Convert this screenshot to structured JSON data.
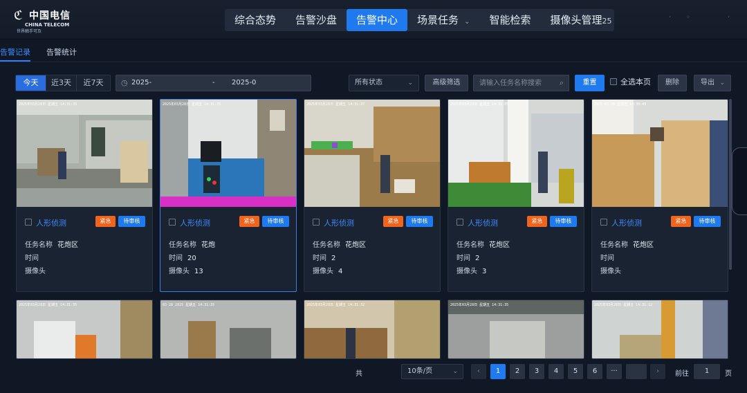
{
  "header": {
    "logo": {
      "cn": "中国电信",
      "en": "CHINA TELECOM",
      "slogan": "世界触手可及"
    },
    "nav": [
      {
        "label": "综合态势"
      },
      {
        "label": "告警沙盘"
      },
      {
        "label": "告警中心",
        "active": true
      },
      {
        "label": "场景任务",
        "has_dropdown": true
      },
      {
        "label": "智能检索"
      },
      {
        "label": "摄像头管理"
      }
    ],
    "nav_overflow": "25"
  },
  "subtabs": [
    {
      "label": "告警记录",
      "active": true
    },
    {
      "label": "告警统计"
    }
  ],
  "toolbar": {
    "ranges": [
      {
        "label": "今天",
        "active": true
      },
      {
        "label": "近3天"
      },
      {
        "label": "近7天"
      }
    ],
    "date_start": "2025-",
    "date_sep": "-",
    "date_end": "2025-0",
    "status_select": "所有状态",
    "advanced_filter": "高级筛选",
    "search_placeholder": "请输入任务名称搜索",
    "reset": "重置",
    "select_all": "全选本页",
    "delete": "删除",
    "export": "导出"
  },
  "cards": [
    {
      "timestamp": "2025年03月28日 星期五 14:31:35",
      "title": "人形侦测",
      "urgent": "紧急",
      "status": "待审核",
      "task_label": "任务名称",
      "task": "花炮区",
      "time_label": "时间",
      "time": "",
      "camera_label": "摄像头",
      "camera": ""
    },
    {
      "timestamp": "2025年03月28日 星期五 14:31:35",
      "title": "人形侦测",
      "urgent": "紧急",
      "status": "待审核",
      "task_label": "任务名称",
      "task": "花炮",
      "time_label": "时间",
      "time": "20",
      "camera_label": "摄像头",
      "camera": "13"
    },
    {
      "timestamp": "2025年03月28日 星期五 14:31:37",
      "title": "人形侦测",
      "urgent": "紧急",
      "status": "待审核",
      "task_label": "任务名称",
      "task": "花炮区",
      "time_label": "时间",
      "time": "2",
      "camera_label": "摄像头",
      "camera": "4"
    },
    {
      "timestamp": "2025年03月28日 星期五 14:31:35",
      "title": "人形侦测",
      "urgent": "紧急",
      "status": "待审核",
      "task_label": "任务名称",
      "task": "花炮区",
      "time_label": "时间",
      "time": "2",
      "camera_label": "摄像头",
      "camera": "3"
    },
    {
      "timestamp": "2025-03-28 星期五 14:30:49",
      "title": "人形侦测",
      "urgent": "紧急",
      "status": "待审核",
      "task_label": "任务名称",
      "task": "花炮区",
      "time_label": "时间",
      "time": "",
      "camera_label": "摄像头",
      "camera": ""
    }
  ],
  "cards_row2": [
    {
      "timestamp": "2025年03月28日 星期五 14:31:35"
    },
    {
      "timestamp": "03-28 2025 星期五 14:31:35"
    },
    {
      "timestamp": "2025年03月28日 星期五 14:31:32"
    },
    {
      "timestamp": "2025年03月28日 星期五 14:31:35"
    },
    {
      "timestamp": "2025年03月28日 星期五 14:31:12"
    }
  ],
  "pager": {
    "total_prefix": "共",
    "page_size": "10条/页",
    "prev": "‹",
    "next": "›",
    "pages": [
      "1",
      "2",
      "3",
      "4",
      "5",
      "6",
      "···"
    ],
    "goto_label": "前往",
    "goto_value": "1",
    "page_suffix": "页"
  }
}
